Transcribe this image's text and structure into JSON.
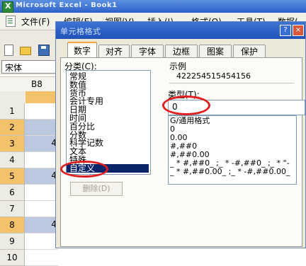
{
  "excel": {
    "title": "Microsoft Excel - Book1",
    "menu": [
      "文件(F)",
      "编辑(E)",
      "视图(V)",
      "插入(I)",
      "格式(O)",
      "工具(T)",
      "数据("
    ],
    "font_name": "宋体",
    "name_box": "B8",
    "column_header": "",
    "rows": [
      {
        "num": "1",
        "value": "",
        "selected": false
      },
      {
        "num": "2",
        "value": "",
        "selected": true
      },
      {
        "num": "3",
        "value": "4",
        "selected": true
      },
      {
        "num": "4",
        "value": "",
        "selected": false
      },
      {
        "num": "5",
        "value": "4",
        "selected": true
      },
      {
        "num": "6",
        "value": "",
        "selected": false
      },
      {
        "num": "7",
        "value": "",
        "selected": false
      },
      {
        "num": "8",
        "value": "4",
        "selected": true
      },
      {
        "num": "9",
        "value": "",
        "selected": false
      },
      {
        "num": "10",
        "value": "",
        "selected": false
      }
    ]
  },
  "dialog": {
    "title": "单元格格式",
    "help_label": "?",
    "close_label": "×",
    "tabs": [
      "数字",
      "对齐",
      "字体",
      "边框",
      "图案",
      "保护"
    ],
    "active_tab": "数字",
    "category_label": "分类(C):",
    "categories": [
      "常规",
      "数值",
      "货币",
      "会计专用",
      "日期",
      "时间",
      "百分比",
      "分数",
      "科学记数",
      "文本",
      "特殊",
      "自定义"
    ],
    "selected_category": "自定义",
    "sample_label": "示例",
    "sample_value": "422254515454156",
    "type_label": "类型(T):",
    "type_value": "0",
    "formats": [
      "G/通用格式",
      "0",
      "0.00",
      "#,##0",
      "#,##0.00",
      "_ * #,##0_ ;_ * -#,##0_ ;_ * \"-",
      "_ * #,##0.00_ ;_ * -#,##0.00_"
    ],
    "delete_label": "删除(D)"
  },
  "colors": {
    "annotation": "#e02020",
    "selection": "#0a246a",
    "highlight_row": "#f4c26b"
  }
}
